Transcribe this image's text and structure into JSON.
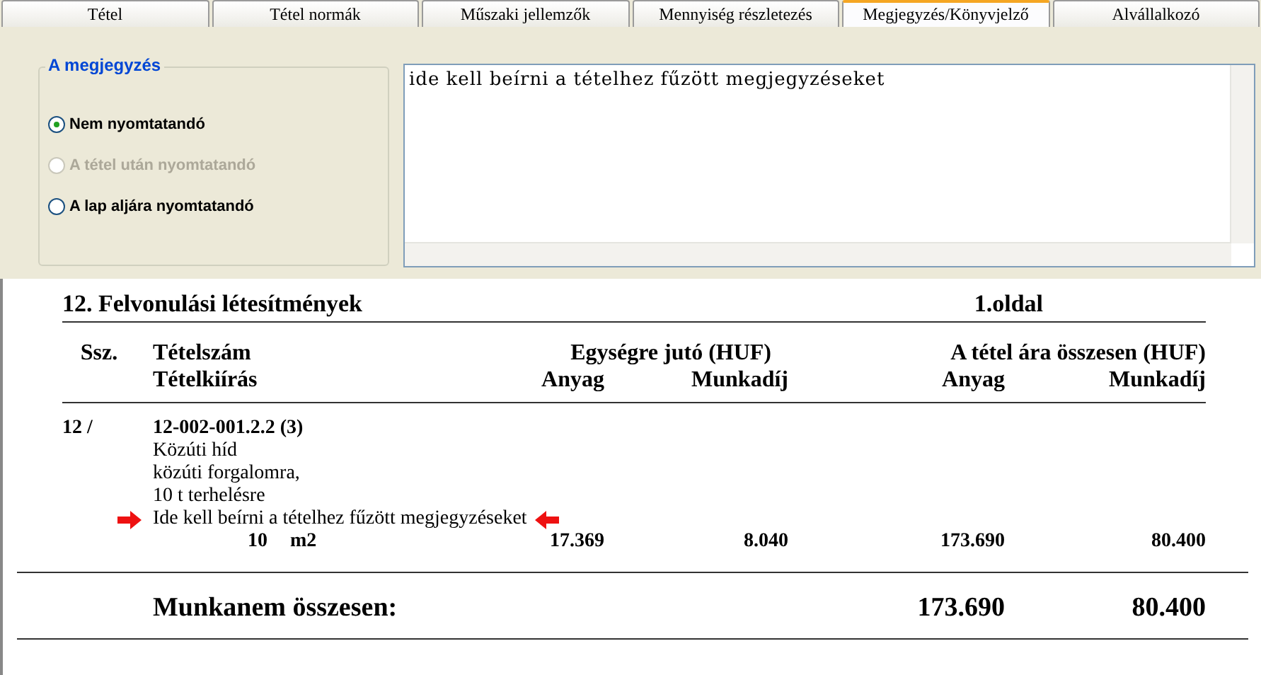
{
  "tabs": [
    {
      "label": "Tétel",
      "selected": false
    },
    {
      "label": "Tétel normák",
      "selected": false
    },
    {
      "label": "Műszaki jellemzők",
      "selected": false
    },
    {
      "label": "Mennyiség részletezés",
      "selected": false
    },
    {
      "label": "Megjegyzés/Könyvjelző",
      "selected": true
    },
    {
      "label": "Alvállalkozó",
      "selected": false
    }
  ],
  "note_group": {
    "title": "A megjegyzés",
    "options": [
      {
        "label": "Nem nyomtatandó",
        "selected": true,
        "disabled": false
      },
      {
        "label": "A tétel után nyomtatandó",
        "selected": false,
        "disabled": true
      },
      {
        "label": "A lap aljára nyomtatandó",
        "selected": false,
        "disabled": false
      }
    ]
  },
  "note_text": "ide kell beírni a tételhez fűzött megjegyzéseket",
  "report": {
    "title": "12. Felvonulási létesítmények",
    "page": "1.oldal",
    "header": {
      "ssz": "Ssz.",
      "item_number": "Tételszám",
      "item_text": "Tételkiírás",
      "unit_group": "Egységre jutó (HUF)",
      "total_group": "A tétel ára összesen (HUF)",
      "unit_material": "Anyag",
      "unit_labour": "Munkadíj",
      "total_material": "Anyag",
      "total_labour": "Munkadíj"
    },
    "items": [
      {
        "ssz": "12 /",
        "code": "12-002-001.2.2 (3)",
        "description": [
          "Közúti híd",
          "közúti forgalomra,",
          "10 t terhelésre"
        ],
        "remark": "Ide kell beírni a tételhez fűzött megjegyzéseket",
        "quantity": "10",
        "unit": "m2",
        "unit_material": "17.369",
        "unit_labour": "8.040",
        "total_material": "173.690",
        "total_labour": "80.400"
      }
    ],
    "total": {
      "label": "Munkanem összesen:",
      "material": "173.690",
      "labour": "80.400"
    }
  }
}
